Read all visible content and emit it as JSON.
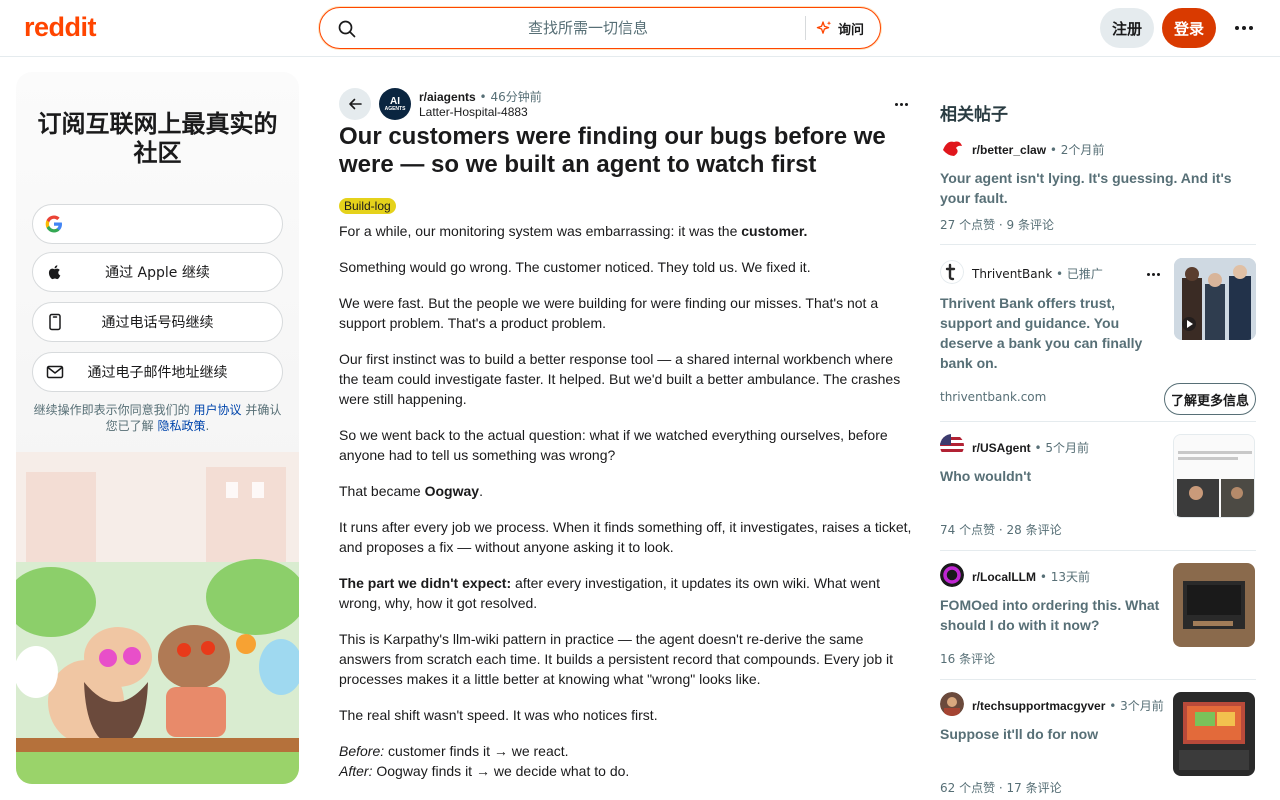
{
  "header": {
    "logo": "reddit",
    "search_placeholder": "查找所需一切信息",
    "ask_label": "询问",
    "signup_label": "注册",
    "login_label": "登录"
  },
  "left_panel": {
    "title": "订阅互联网上最真实的社区",
    "google_label": "",
    "apple_label": "通过 Apple 继续",
    "phone_label": "通过电话号码继续",
    "email_label": "通过电子邮件地址继续",
    "legal_prefix": "继续操作即表示你同意我们的 ",
    "user_agreement": "用户协议",
    "legal_middle": " 并确认您已了解 ",
    "privacy_policy": "隐私政策",
    "legal_suffix": "."
  },
  "post": {
    "subreddit": "r/aiagents",
    "time": "46分钟前",
    "author": "Latter-Hospital-4883",
    "avatar_text_1": "AI",
    "avatar_text_2": "AGENTS",
    "title": "Our customers were finding our bugs before we were — so we built an agent to watch first",
    "flair": "Build-log",
    "p1_a": "For a while, our monitoring system was embarrassing: it was the ",
    "p1_b": "customer.",
    "p2": "Something would go wrong. The customer noticed. They told us. We fixed it.",
    "p3": "We were fast. But the people we were building for were finding our misses. That's not a support problem. That's a product problem.",
    "p4": "Our first instinct was to build a better response tool — a shared internal workbench where the team could investigate faster. It helped. But we'd built a better ambulance. The crashes were still happening.",
    "p5": "So we went back to the actual question: what if we watched everything ourselves, before anyone had to tell us something was wrong?",
    "p6_a": "That became ",
    "p6_b": "Oogway",
    "p6_c": ".",
    "p7": "It runs after every job we process. When it finds something off, it investigates, raises a ticket, and proposes a fix — without anyone asking it to look.",
    "p8_a": "The part we didn't expect:",
    "p8_b": " after every investigation, it updates its own wiki. What went wrong, why, how it got resolved.",
    "p9": "This is Karpathy's llm-wiki pattern in practice — the agent doesn't re-derive the same answers from scratch each time. It builds a persistent record that compounds. Every job it processes makes it a little better at knowing what \"wrong\" looks like.",
    "p10": "The real shift wasn't speed. It was who notices first.",
    "p11_a": "Before:",
    "p11_b": " customer finds it ",
    "p11_arrow": "→",
    "p11_c": " we react.",
    "p12_a": "After:",
    "p12_b": " Oogway finds it ",
    "p12_arrow": "→",
    "p12_c": " we decide what to do."
  },
  "rail": {
    "title": "相关帖子",
    "items": [
      {
        "subreddit": "r/better_claw",
        "time": "2个月前",
        "title": "Your agent isn't lying. It's guessing. And it's your fault.",
        "stats": "27 个点赞 · 9 条评论"
      },
      {
        "subreddit": "ThriventBank",
        "time": "已推广",
        "title": "Thrivent Bank offers trust, support and guidance. You deserve a bank you can finally bank on.",
        "domain": "thriventbank.com",
        "cta": "了解更多信息"
      },
      {
        "subreddit": "r/USAgent",
        "time": "5个月前",
        "title": "Who wouldn't",
        "stats": "74 个点赞 · 28 条评论"
      },
      {
        "subreddit": "r/LocalLLM",
        "time": "13天前",
        "title": "FOMOed into ordering this. What should I do with it now?",
        "stats": "16 条评论"
      },
      {
        "subreddit": "r/techsupportmacgyver",
        "time": "3个月前",
        "title": "Suppose it'll do for now",
        "stats": "62 个点赞 · 17 条评论"
      }
    ]
  },
  "colors": {
    "brand": "#ff4500",
    "login": "#d93a00",
    "flair": "#e5d21b",
    "link": "#0045ac"
  },
  "icons": [
    "search-icon",
    "ask-sparkle-icon",
    "more-icon",
    "google-icon",
    "apple-icon",
    "phone-icon",
    "mail-icon",
    "back-arrow-icon",
    "play-icon"
  ]
}
